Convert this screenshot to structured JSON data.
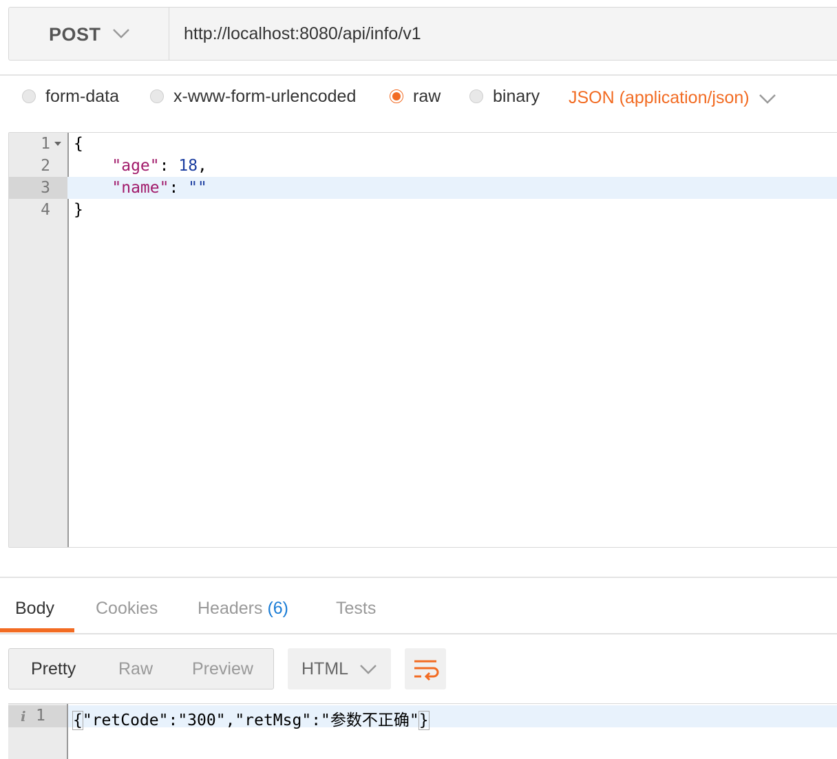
{
  "request": {
    "method": "POST",
    "url": "http://localhost:8080/api/info/v1"
  },
  "body_types": [
    {
      "label": "form-data",
      "selected": false
    },
    {
      "label": "x-www-form-urlencoded",
      "selected": false
    },
    {
      "label": "raw",
      "selected": true
    },
    {
      "label": "binary",
      "selected": false
    }
  ],
  "content_type": "JSON (application/json)",
  "editor": {
    "lines": [
      {
        "num": "1",
        "text": "{"
      },
      {
        "num": "2",
        "key": "\"age\"",
        "sep": ": ",
        "value": "18",
        "tail": ","
      },
      {
        "num": "3",
        "key": "\"name\"",
        "sep": ": ",
        "value": "\"\""
      },
      {
        "num": "4",
        "text": "}"
      }
    ]
  },
  "response": {
    "tabs": [
      {
        "label": "Body",
        "active": true
      },
      {
        "label": "Cookies",
        "active": false
      },
      {
        "label": "Headers",
        "count": "(6)",
        "active": false
      },
      {
        "label": "Tests",
        "active": false
      }
    ],
    "formats": [
      {
        "label": "Pretty",
        "active": true
      },
      {
        "label": "Raw",
        "active": false
      },
      {
        "label": "Preview",
        "active": false
      }
    ],
    "language": "HTML",
    "line_num": "1",
    "body_open": "{",
    "body_rest": "\"retCode\":\"300\",\"retMsg\":\"参数不正确\"",
    "body_close": "}"
  },
  "colors": {
    "accent": "#f26b22",
    "link": "#1a7cd5"
  }
}
